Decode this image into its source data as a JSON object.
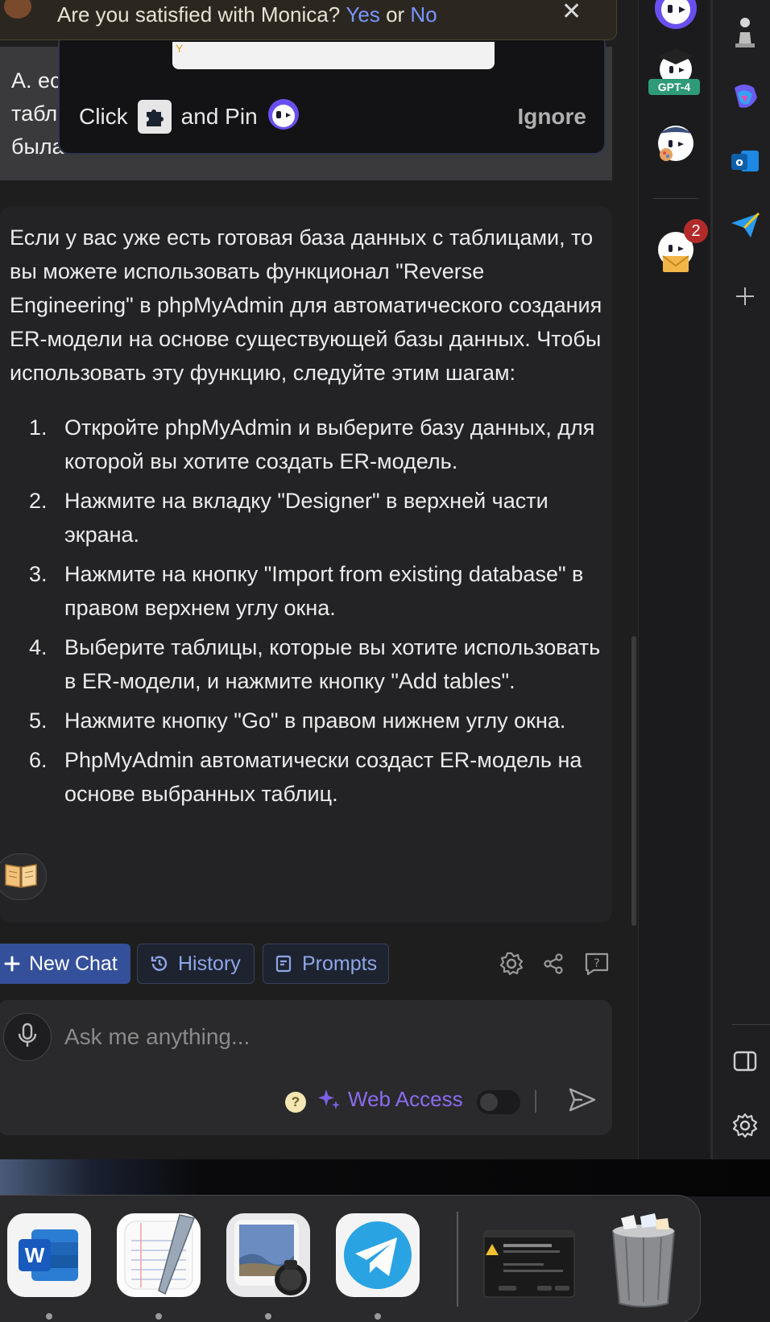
{
  "banner": {
    "question": "Are you satisfied with Monica?",
    "yes": "Yes",
    "or": "or",
    "no": "No"
  },
  "pin_popup": {
    "click_label": "Click",
    "and_pin_label": "and Pin",
    "ignore_label": "Ignore",
    "input_hint": "Y"
  },
  "user_message": {
    "visible_lines": [
      "А. ес",
      "табл",
      "была готова"
    ]
  },
  "answer": {
    "intro": "Если у вас уже есть готовая база данных с таблицами, то вы можете использовать функционал \"Reverse Engineering\" в phpMyAdmin для автоматического создания ER-модели на основе существующей базы данных. Чтобы использовать эту функцию, следуйте этим шагам:",
    "steps": [
      {
        "num": "1.",
        "text": "Откройте phpMyAdmin и выберите базу данных, для которой вы хотите создать ER-модель."
      },
      {
        "num": "2.",
        "text": "Нажмите на вкладку \"Designer\" в верхней части экрана."
      },
      {
        "num": "3.",
        "text": "Нажмите на кнопку \"Import from existing database\" в правом верхнем углу окна."
      },
      {
        "num": "4.",
        "text": "Выберите таблицы, которые вы хотите использовать в ER-модели, и нажмите кнопку \"Add tables\"."
      },
      {
        "num": "5.",
        "text": "Нажмите кнопку \"Go\" в правом нижнем углу окна."
      },
      {
        "num": "6.",
        "text": "PhpMyAdmin автоматически создаст ER-модель на основе выбранных таблиц."
      }
    ]
  },
  "toolbar": {
    "new_chat": "New Chat",
    "history": "History",
    "prompts": "Prompts"
  },
  "input": {
    "placeholder": "Ask me anything...",
    "help": "?",
    "web_access": "Web Access",
    "web_access_enabled": false
  },
  "monica_sidebar": {
    "gpt4_badge": "GPT-4",
    "notification_count": "2"
  },
  "dock": {
    "apps": [
      "microsoft-word",
      "textedit",
      "preview",
      "telegram"
    ],
    "word_letter": "W"
  },
  "colors": {
    "accent_blue": "#35509a",
    "link_blue": "#7a96ff",
    "web_access_purple": "#8b6bef",
    "badge_red": "#b32a2a"
  }
}
